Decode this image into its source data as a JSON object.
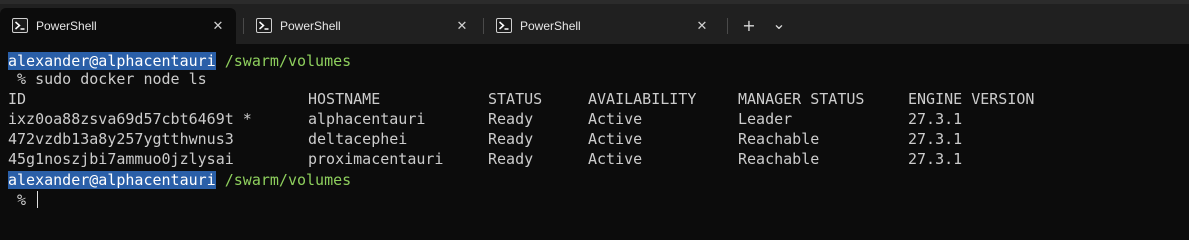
{
  "tabs": [
    {
      "label": "PowerShell",
      "active": true,
      "close": "✕"
    },
    {
      "label": "PowerShell",
      "active": false,
      "close": "✕"
    },
    {
      "label": "PowerShell",
      "active": false,
      "close": "✕"
    }
  ],
  "new_tab_label": "+",
  "dropdown_label": "⌄",
  "terminal": {
    "user_host": "alexander@alphacentauri",
    "cwd": "/swarm/volumes",
    "prompt_symbol": " %",
    "command": "sudo docker node ls",
    "headers": [
      "ID",
      "HOSTNAME",
      "STATUS",
      "AVAILABILITY",
      "MANAGER STATUS",
      "ENGINE VERSION"
    ],
    "rows": [
      {
        "id": "ixz0oa88zsva69d57cbt6469t *",
        "hostname": "alphacentauri",
        "status": "Ready",
        "availability": "Active",
        "manager_status": "Leader",
        "engine_version": "27.3.1"
      },
      {
        "id": "472vzdb13a8y257ygtthwnus3",
        "hostname": "deltacephei",
        "status": "Ready",
        "availability": "Active",
        "manager_status": "Reachable",
        "engine_version": "27.3.1"
      },
      {
        "id": "45g1noszjbi7ammuo0jzlysai",
        "hostname": "proximacentauri",
        "status": "Ready",
        "availability": "Active",
        "manager_status": "Reachable",
        "engine_version": "27.3.1"
      }
    ]
  },
  "colors": {
    "background": "#0c0c0c",
    "tabstrip": "#202020",
    "user_host_bg": "#2a5fa8",
    "cwd_text": "#8ecf5d",
    "text": "#cccccc"
  }
}
